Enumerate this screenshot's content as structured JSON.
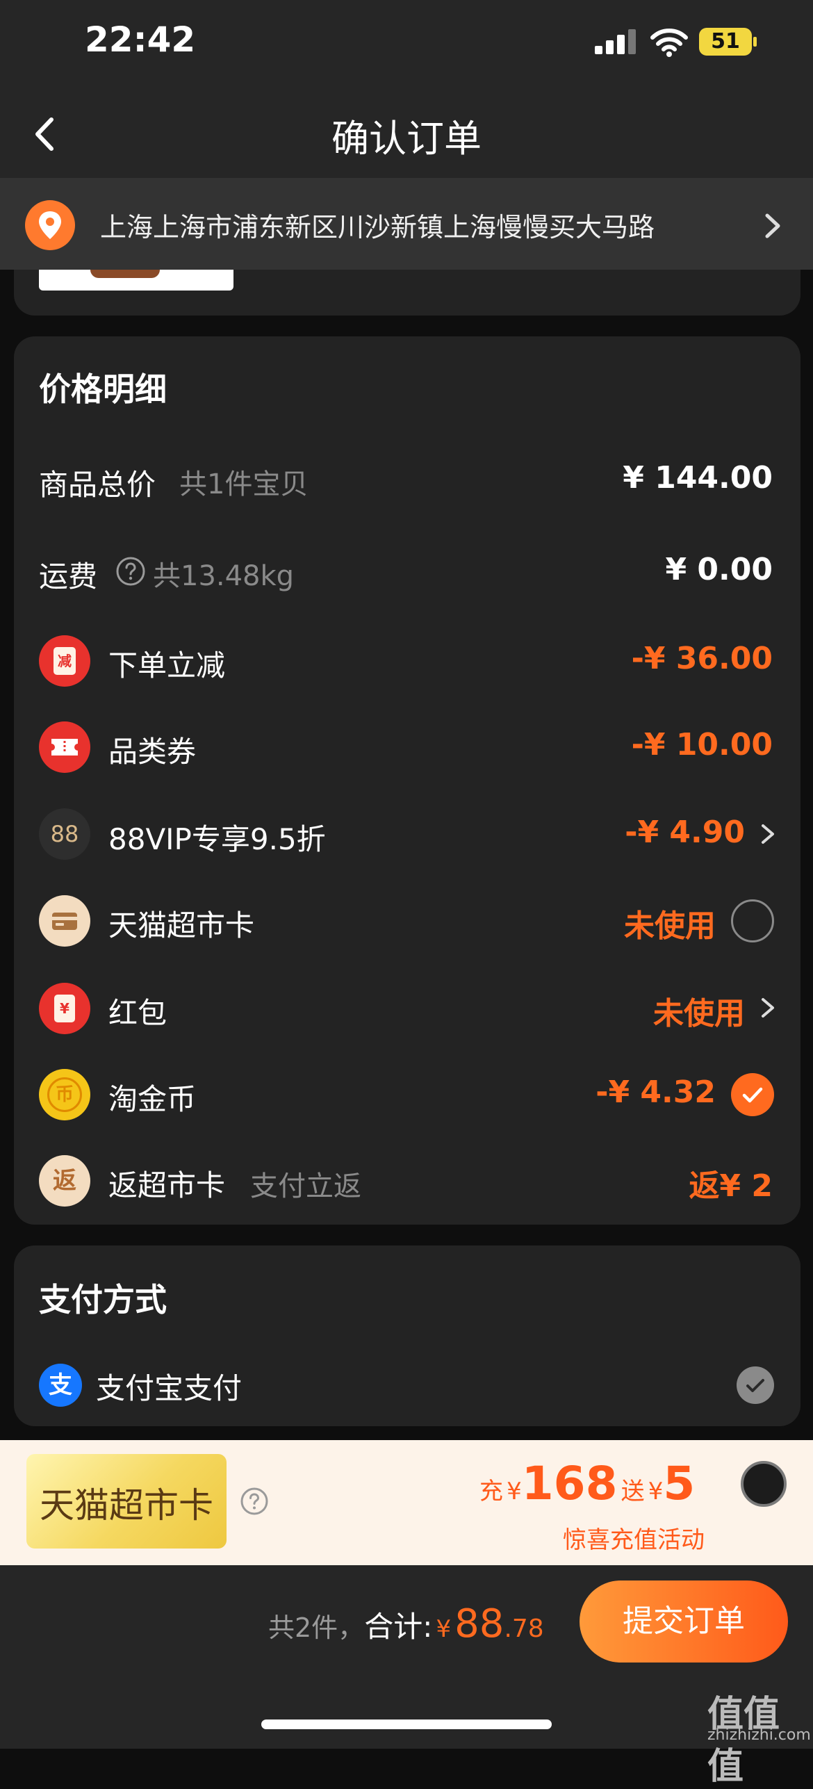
{
  "status_bar": {
    "time": "22:42",
    "battery": "51"
  },
  "header": {
    "title": "确认订单"
  },
  "address": {
    "text": "上海上海市浦东新区川沙新镇上海慢慢买大马路"
  },
  "price_detail": {
    "title": "价格明细",
    "rows": [
      {
        "label": "商品总价",
        "sub": "共1件宝贝",
        "value": "¥ 144.00"
      },
      {
        "label": "运费",
        "sub": "共13.48kg",
        "value": "¥ 0.00"
      },
      {
        "label": "下单立减",
        "icon": "coupon-red-icon",
        "value": "-¥ 36.00"
      },
      {
        "label": "品类券",
        "icon": "ticket-icon",
        "value": "-¥ 10.00"
      },
      {
        "label": "88VIP专享9.5折",
        "icon": "88vip-icon",
        "value": "-¥ 4.90"
      },
      {
        "label": "天猫超市卡",
        "icon": "card-icon",
        "value": "未使用"
      },
      {
        "label": "红包",
        "icon": "red-packet-icon",
        "value": "未使用"
      },
      {
        "label": "淘金币",
        "icon": "gold-coin-icon",
        "value": "-¥ 4.32"
      },
      {
        "label": "返超市卡",
        "sub": "支付立返",
        "icon": "return-icon",
        "value": "返¥ 2"
      }
    ],
    "icon_glyphs": {
      "coupon": "减",
      "vip": "88",
      "red_packet": "¥",
      "coin": "币",
      "return": "返"
    }
  },
  "payment": {
    "title": "支付方式",
    "method": "支付宝支付",
    "method_icon_glyph": "支"
  },
  "promo": {
    "card_text": "天猫超市卡",
    "charge_prefix": "充",
    "currency": "¥",
    "charge_amount": "168",
    "bonus_prefix": "送",
    "bonus_amount": "5",
    "subtitle": "惊喜充值活动"
  },
  "bottom_bar": {
    "count": "共2件，",
    "total_label": "合计:",
    "currency": "¥",
    "total_int": "88",
    "total_dec": ".78",
    "submit": "提交订单"
  },
  "watermark": {
    "logo": "值值值",
    "site": "zhizhizhi.com"
  },
  "colors": {
    "accent": "#ff6a1f",
    "card_bg": "#232323",
    "page_bg": "#0e0e0e"
  }
}
